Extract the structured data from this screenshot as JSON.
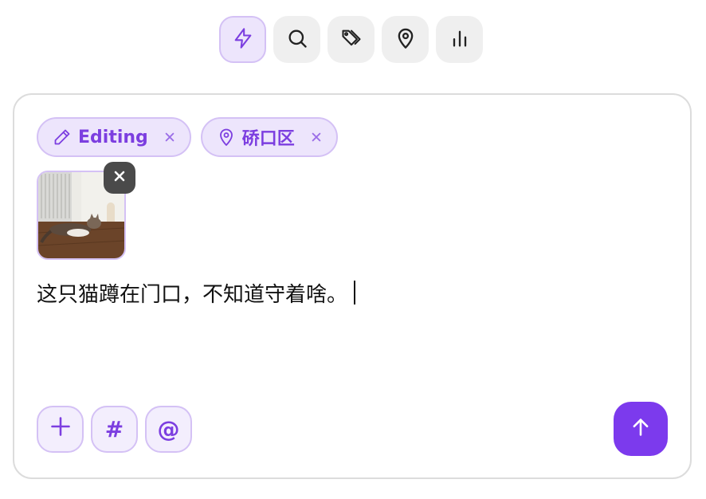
{
  "toolbar": {
    "modes": [
      {
        "icon": "lightning-icon",
        "active": true
      },
      {
        "icon": "search-icon",
        "active": false
      },
      {
        "icon": "tags-icon",
        "active": false
      },
      {
        "icon": "map-pin-icon",
        "active": false
      },
      {
        "icon": "bar-chart-icon",
        "active": false
      }
    ]
  },
  "composer": {
    "chips": [
      {
        "icon": "pencil-icon",
        "label": "Editing"
      },
      {
        "icon": "map-pin-icon",
        "label": "硚口区"
      }
    ],
    "attachment": {
      "icon": "cat-photo-thumbnail"
    },
    "text": "这只猫蹲在门口，不知道守着啥。",
    "tools": [
      {
        "icon": "plus-icon",
        "label": "+"
      },
      {
        "icon": "hash-icon",
        "label": "#"
      },
      {
        "icon": "at-icon",
        "label": "@"
      }
    ]
  },
  "colors": {
    "accent": "#7c3aed",
    "chip_bg": "#ede5fc",
    "chip_border": "#d4c1f5",
    "chip_text": "#7c3ee0"
  }
}
